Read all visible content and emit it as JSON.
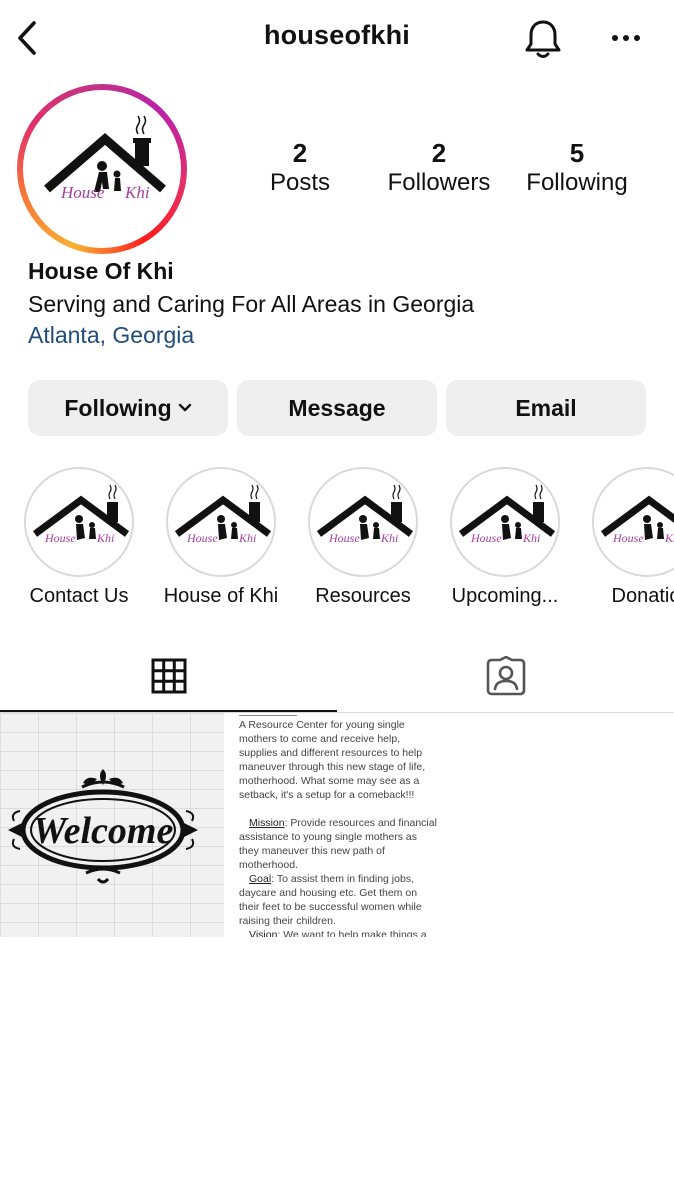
{
  "header": {
    "username": "houseofkhi",
    "back_icon": "chevron-left-icon",
    "notification_icon": "bell-icon",
    "more_icon": "more-horizontal-icon"
  },
  "profile": {
    "logo_text_1": "House",
    "logo_text_2": "Khi",
    "name": "House Of Khi",
    "bio": "Serving and Caring For All Areas in Georgia",
    "location": "Atlanta, Georgia",
    "location_color": "#1f4b7a",
    "ring_colors": [
      "#f9b233",
      "#f77737",
      "#e1306c",
      "#c13584"
    ]
  },
  "stats": [
    {
      "value": "2",
      "label": "Posts"
    },
    {
      "value": "2",
      "label": "Followers"
    },
    {
      "value": "5",
      "label": "Following"
    }
  ],
  "actions": {
    "following": "Following",
    "message": "Message",
    "email": "Email"
  },
  "highlights": [
    {
      "label": "Contact Us"
    },
    {
      "label": "House of Khi"
    },
    {
      "label": "Resources"
    },
    {
      "label": "Upcoming..."
    },
    {
      "label": "Donatio"
    }
  ],
  "tabs": [
    {
      "name": "grid",
      "icon": "grid-icon",
      "active": true
    },
    {
      "name": "tagged",
      "icon": "tagged-user-icon",
      "active": false
    }
  ],
  "posts": {
    "welcome_text": "Welcome",
    "text_post": {
      "intro": "A Resource Center for young single mothers to come and receive help, supplies and different resources to help maneuver through this new stage of life, motherhood. What some may see as a setback, it's a setup for a comeback!!!",
      "mission_label": "Mission",
      "mission_text": ": Provide resources and financial assistance to young single mothers as they maneuver this new path of motherhood.",
      "goal_label": "Goal",
      "goal_text": ": To assist them in finding jobs, daycare and housing etc. Get them on their feet to be successful women while raising their children.",
      "vision_label": "Vision",
      "vision_text": ": We want to help make things a little easier and help things make sense."
    }
  }
}
